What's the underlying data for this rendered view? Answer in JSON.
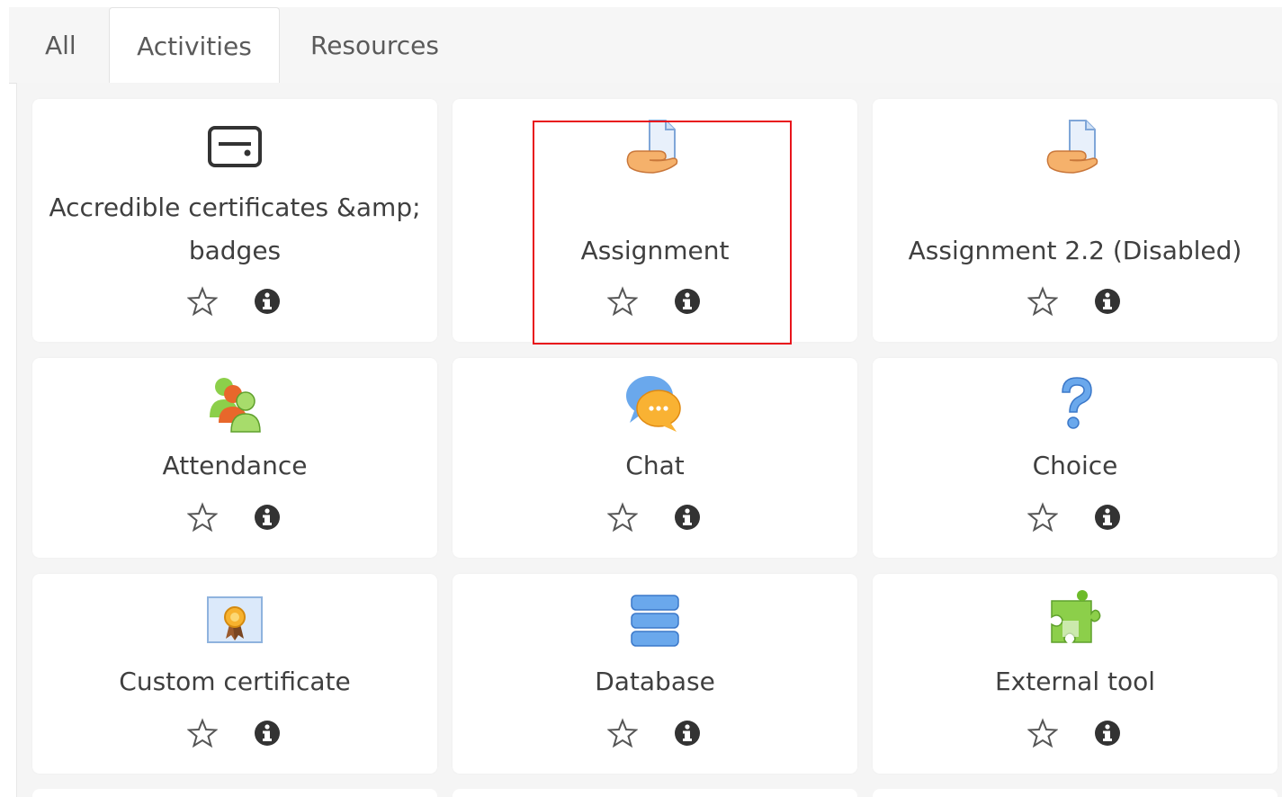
{
  "tabs": [
    {
      "label": "All"
    },
    {
      "label": "Activities"
    },
    {
      "label": "Resources"
    }
  ],
  "active_tab": "Activities",
  "highlight_color": "#e8141c",
  "modules": [
    {
      "name": "Accredible certificates &amp; badges",
      "icon": "certificate-card-icon"
    },
    {
      "name": "Assignment",
      "icon": "assignment-icon"
    },
    {
      "name": "Assignment 2.2 (Disabled)",
      "icon": "assignment-icon"
    },
    {
      "name": "Attendance",
      "icon": "attendance-icon"
    },
    {
      "name": "Chat",
      "icon": "chat-icon"
    },
    {
      "name": "Choice",
      "icon": "choice-icon"
    },
    {
      "name": "Custom certificate",
      "icon": "custom-certificate-icon"
    },
    {
      "name": "Database",
      "icon": "database-icon"
    },
    {
      "name": "External tool",
      "icon": "external-tool-icon"
    }
  ]
}
